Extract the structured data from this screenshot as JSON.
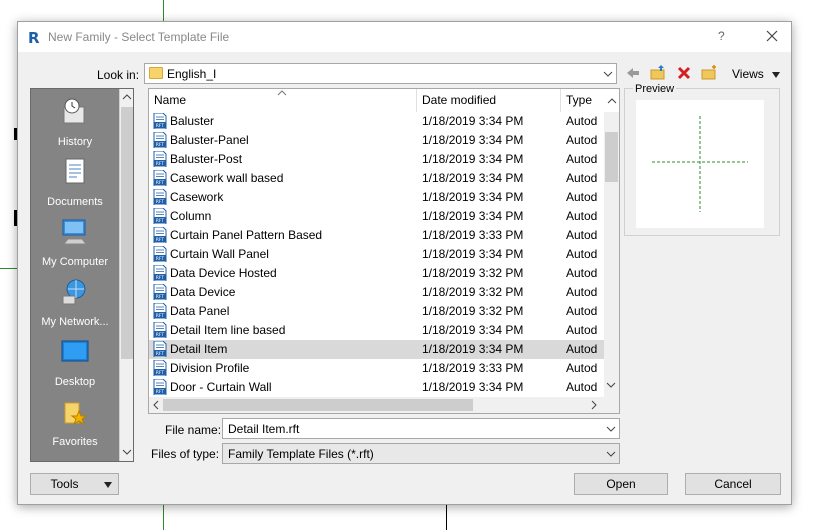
{
  "window": {
    "app_icon": "R",
    "title": "New Family - Select Template File",
    "help": "?"
  },
  "lookin": {
    "label": "Look in:",
    "value": "English_I"
  },
  "toolbar": {
    "icons": [
      "back-arrow-icon",
      "up-folder-icon",
      "delete-icon",
      "new-folder-icon"
    ],
    "views_label": "Views"
  },
  "places": [
    {
      "label": "History",
      "icon": "history-icon"
    },
    {
      "label": "Documents",
      "icon": "documents-icon"
    },
    {
      "label": "My Computer",
      "icon": "computer-icon"
    },
    {
      "label": "My Network...",
      "icon": "network-icon"
    },
    {
      "label": "Desktop",
      "icon": "desktop-icon"
    },
    {
      "label": "Favorites",
      "icon": "favorites-icon"
    }
  ],
  "columns": {
    "name": "Name",
    "date": "Date modified",
    "type": "Type"
  },
  "files": [
    {
      "name": "Baluster",
      "date": "1/18/2019 3:34 PM",
      "type": "Autod"
    },
    {
      "name": "Baluster-Panel",
      "date": "1/18/2019 3:34 PM",
      "type": "Autod"
    },
    {
      "name": "Baluster-Post",
      "date": "1/18/2019 3:34 PM",
      "type": "Autod"
    },
    {
      "name": "Casework wall based",
      "date": "1/18/2019 3:34 PM",
      "type": "Autod"
    },
    {
      "name": "Casework",
      "date": "1/18/2019 3:34 PM",
      "type": "Autod"
    },
    {
      "name": "Column",
      "date": "1/18/2019 3:34 PM",
      "type": "Autod"
    },
    {
      "name": "Curtain Panel Pattern Based",
      "date": "1/18/2019 3:33 PM",
      "type": "Autod"
    },
    {
      "name": "Curtain Wall Panel",
      "date": "1/18/2019 3:34 PM",
      "type": "Autod"
    },
    {
      "name": "Data Device Hosted",
      "date": "1/18/2019 3:32 PM",
      "type": "Autod"
    },
    {
      "name": "Data Device",
      "date": "1/18/2019 3:32 PM",
      "type": "Autod"
    },
    {
      "name": "Data Panel",
      "date": "1/18/2019 3:32 PM",
      "type": "Autod"
    },
    {
      "name": "Detail Item line based",
      "date": "1/18/2019 3:34 PM",
      "type": "Autod"
    },
    {
      "name": "Detail Item",
      "date": "1/18/2019 3:34 PM",
      "type": "Autod",
      "selected": true
    },
    {
      "name": "Division Profile",
      "date": "1/18/2019 3:33 PM",
      "type": "Autod"
    },
    {
      "name": "Door - Curtain Wall",
      "date": "1/18/2019 3:34 PM",
      "type": "Autod"
    }
  ],
  "file_icon_text": "RFT",
  "preview": {
    "label": "Preview"
  },
  "filename": {
    "label": "File name:",
    "value": "Detail Item.rft"
  },
  "filetype": {
    "label": "Files of type:",
    "value": "Family Template Files  (*.rft)"
  },
  "buttons": {
    "tools": "Tools",
    "open": "Open",
    "cancel": "Cancel"
  },
  "background_text": "te",
  "colors": {
    "accent": "#1f5fa8",
    "selection": "#d9d9d9",
    "places_bg": "#848484",
    "preview_line": "#2e8b2e"
  }
}
